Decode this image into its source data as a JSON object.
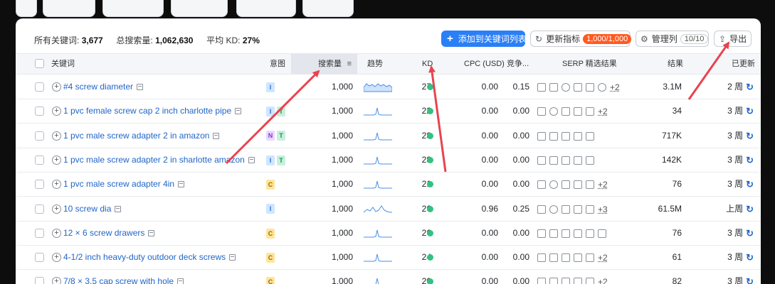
{
  "summary": {
    "all_keywords_label": "所有关键词:",
    "all_keywords_value": "3,677",
    "total_volume_label": "总搜索量:",
    "total_volume_value": "1,062,630",
    "avg_kd_label": "平均 KD:",
    "avg_kd_value": "27%"
  },
  "toolbar": {
    "add_label": "添加到关键词列表",
    "refresh_label": "更新指标",
    "refresh_badge": "1,000/1,000",
    "manage_label": "管理列",
    "manage_count": "10/10",
    "export_label": "导出"
  },
  "columns": {
    "keyword": "关键词",
    "intent": "意图",
    "volume": "搜索量",
    "trend": "趋势",
    "kd": "KD",
    "cpc": "CPC (USD)",
    "competition": "竞争...",
    "serp": "SERP 精选结果",
    "results": "结果",
    "updated": "已更新"
  },
  "rows": [
    {
      "keyword": "#4 screw diameter",
      "intents": [
        "I"
      ],
      "volume": "1,000",
      "kd": "27",
      "cpc": "0.00",
      "comp": "0.15",
      "serp_more": "+2",
      "results": "3.1M",
      "updated": "2 周",
      "trend_shape": "flat"
    },
    {
      "keyword": "1 pvc female screw cap 2 inch charlotte pipe",
      "intents": [
        "I",
        "T"
      ],
      "volume": "1,000",
      "kd": "22",
      "cpc": "0.00",
      "comp": "0.00",
      "serp_more": "+2",
      "results": "34",
      "updated": "3 周",
      "trend_shape": "spike"
    },
    {
      "keyword": "1 pvc male screw adapter 2 in amazon",
      "intents": [
        "N",
        "T"
      ],
      "volume": "1,000",
      "kd": "28",
      "cpc": "0.00",
      "comp": "0.00",
      "serp_more": "",
      "results": "717K",
      "updated": "3 周",
      "trend_shape": "spike"
    },
    {
      "keyword": "1 pvc male screw adapter 2 in sharlotte amazon",
      "intents": [
        "I",
        "T"
      ],
      "volume": "1,000",
      "kd": "28",
      "cpc": "0.00",
      "comp": "0.00",
      "serp_more": "",
      "results": "142K",
      "updated": "3 周",
      "trend_shape": "spike"
    },
    {
      "keyword": "1 pvc male screw adapter 4in",
      "intents": [
        "C"
      ],
      "volume": "1,000",
      "kd": "21",
      "cpc": "0.00",
      "comp": "0.00",
      "serp_more": "+2",
      "results": "76",
      "updated": "3 周",
      "trend_shape": "spike"
    },
    {
      "keyword": "10 screw dia",
      "intents": [
        "I"
      ],
      "volume": "1,000",
      "kd": "26",
      "cpc": "0.96",
      "comp": "0.25",
      "serp_more": "+3",
      "results": "61.5M",
      "updated": "上周",
      "trend_shape": "wave"
    },
    {
      "keyword": "12 × 6 screw drawers",
      "intents": [
        "C"
      ],
      "volume": "1,000",
      "kd": "26",
      "cpc": "0.00",
      "comp": "0.00",
      "serp_more": "",
      "results": "76",
      "updated": "3 周",
      "trend_shape": "spike"
    },
    {
      "keyword": "4-1/2 inch heavy-duty outdoor deck screws",
      "intents": [
        "C"
      ],
      "volume": "1,000",
      "kd": "24",
      "cpc": "0.00",
      "comp": "0.00",
      "serp_more": "+2",
      "results": "61",
      "updated": "3 周",
      "trend_shape": "spike"
    },
    {
      "keyword": "7/8 × 3.5 cap screw with hole",
      "intents": [
        "C"
      ],
      "volume": "1,000",
      "kd": "20",
      "cpc": "0.00",
      "comp": "0.00",
      "serp_more": "+2",
      "results": "82",
      "updated": "3 周",
      "trend_shape": "spike"
    }
  ],
  "colors": {
    "accent": "#2b7ff6",
    "kd_easy": "#33c27f",
    "annotation_arrow": "#e8434f",
    "badge_orange": "#ff5a1f"
  }
}
